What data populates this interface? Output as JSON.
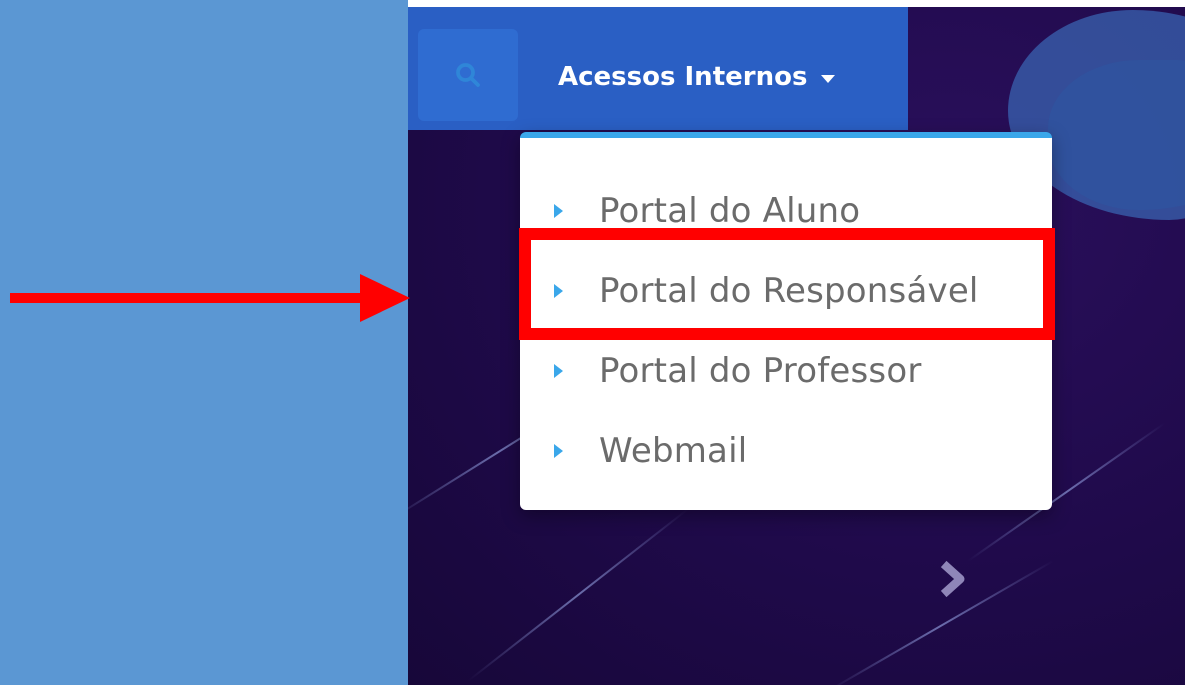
{
  "navbar": {
    "search_icon": "search-icon",
    "dropdown_label": "Acessos Internos",
    "caret_icon": "caret-down-icon"
  },
  "dropdown": {
    "items": [
      {
        "label": "Portal do Aluno",
        "icon": "triangle-right-icon"
      },
      {
        "label": "Portal do Responsável",
        "icon": "triangle-right-icon"
      },
      {
        "label": "Portal do Professor",
        "icon": "triangle-right-icon"
      },
      {
        "label": "Webmail",
        "icon": "triangle-right-icon"
      }
    ],
    "highlighted_item": "Portal do Responsável"
  },
  "slider": {
    "next_icon": "chevron-right-icon"
  },
  "colors": {
    "page_background": "#5b97d3",
    "navbar": "#2a5fc4",
    "dropdown_accent": "#3aa7ea",
    "annotation": "#ff0000",
    "hero_background": "#1f0a4a"
  }
}
